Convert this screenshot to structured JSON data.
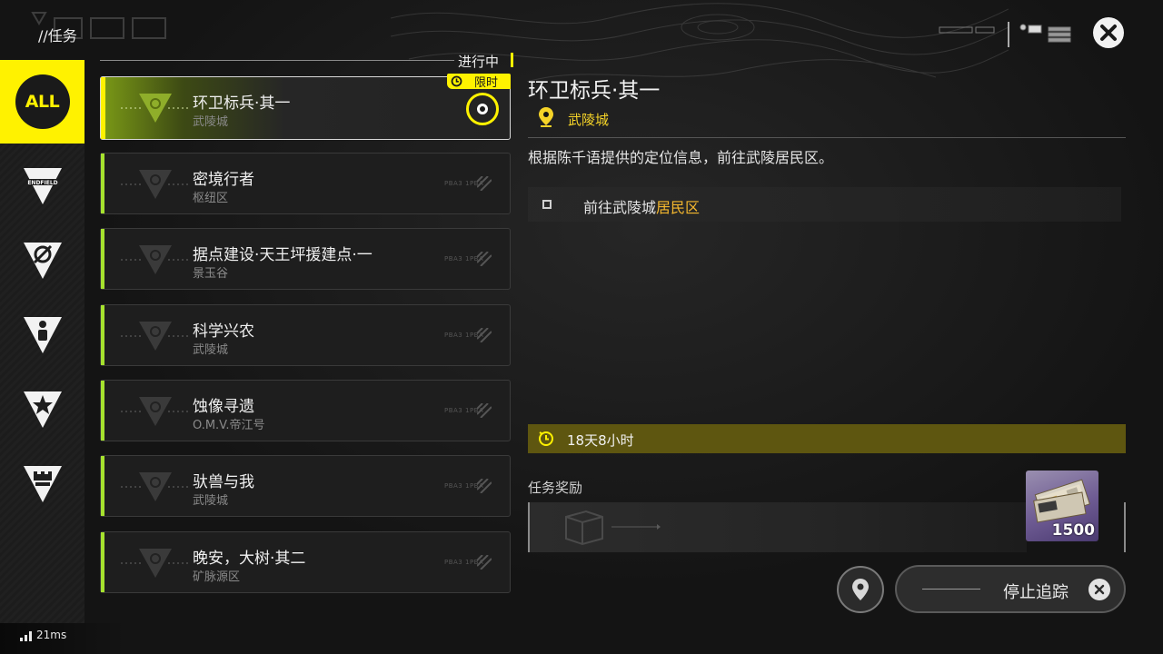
{
  "header": {
    "title": "//任务",
    "close_icon": "close-icon"
  },
  "sidebar": {
    "items": [
      {
        "label": "ALL",
        "icon": "all-filter-badge",
        "selected": true
      },
      {
        "label": "ENDFIELD",
        "icon": "endfield-triangle-icon",
        "selected": false
      },
      {
        "label": "",
        "icon": "slash-circle-triangle-icon",
        "selected": false
      },
      {
        "label": "",
        "icon": "person-triangle-icon",
        "selected": false
      },
      {
        "label": "",
        "icon": "star-triangle-icon",
        "selected": false
      },
      {
        "label": "",
        "icon": "castle-triangle-icon",
        "selected": false
      }
    ]
  },
  "quest_list": {
    "section_label": "进行中",
    "limited_badge": "限时",
    "quests": [
      {
        "name": "环卫标兵·其一",
        "area": "武陵城",
        "active": true
      },
      {
        "name": "密境行者",
        "area": "枢纽区",
        "active": false
      },
      {
        "name": "据点建设·天王坪援建点·一",
        "area": "景玉谷",
        "active": false
      },
      {
        "name": "科学兴农",
        "area": "武陵城",
        "active": false
      },
      {
        "name": "蚀像寻遗",
        "area": "O.M.V.帝江号",
        "active": false
      },
      {
        "name": "驮兽与我",
        "area": "武陵城",
        "active": false
      },
      {
        "name": "晚安，大树·其二",
        "area": "矿脉源区",
        "active": false
      }
    ],
    "watermark": "PBA3 1PBA"
  },
  "detail": {
    "title": "环卫标兵·其一",
    "location": "武陵城",
    "description": "根据陈千语提供的定位信息，前往武陵居民区。",
    "objective_prefix": "前往武陵城",
    "objective_highlight": "居民区",
    "time_left": "18天8小时",
    "rewards_label": "任务奖励",
    "reward_count": "1500"
  },
  "actions": {
    "map_icon": "map-pin-icon",
    "stop_tracking_label": "停止追踪"
  },
  "status": {
    "ping": "21ms"
  },
  "colors": {
    "accent_yellow": "#fff200",
    "accent_green": "#a6e22e",
    "highlight_orange": "#f5b82e",
    "timer_bar": "#5e5610"
  }
}
